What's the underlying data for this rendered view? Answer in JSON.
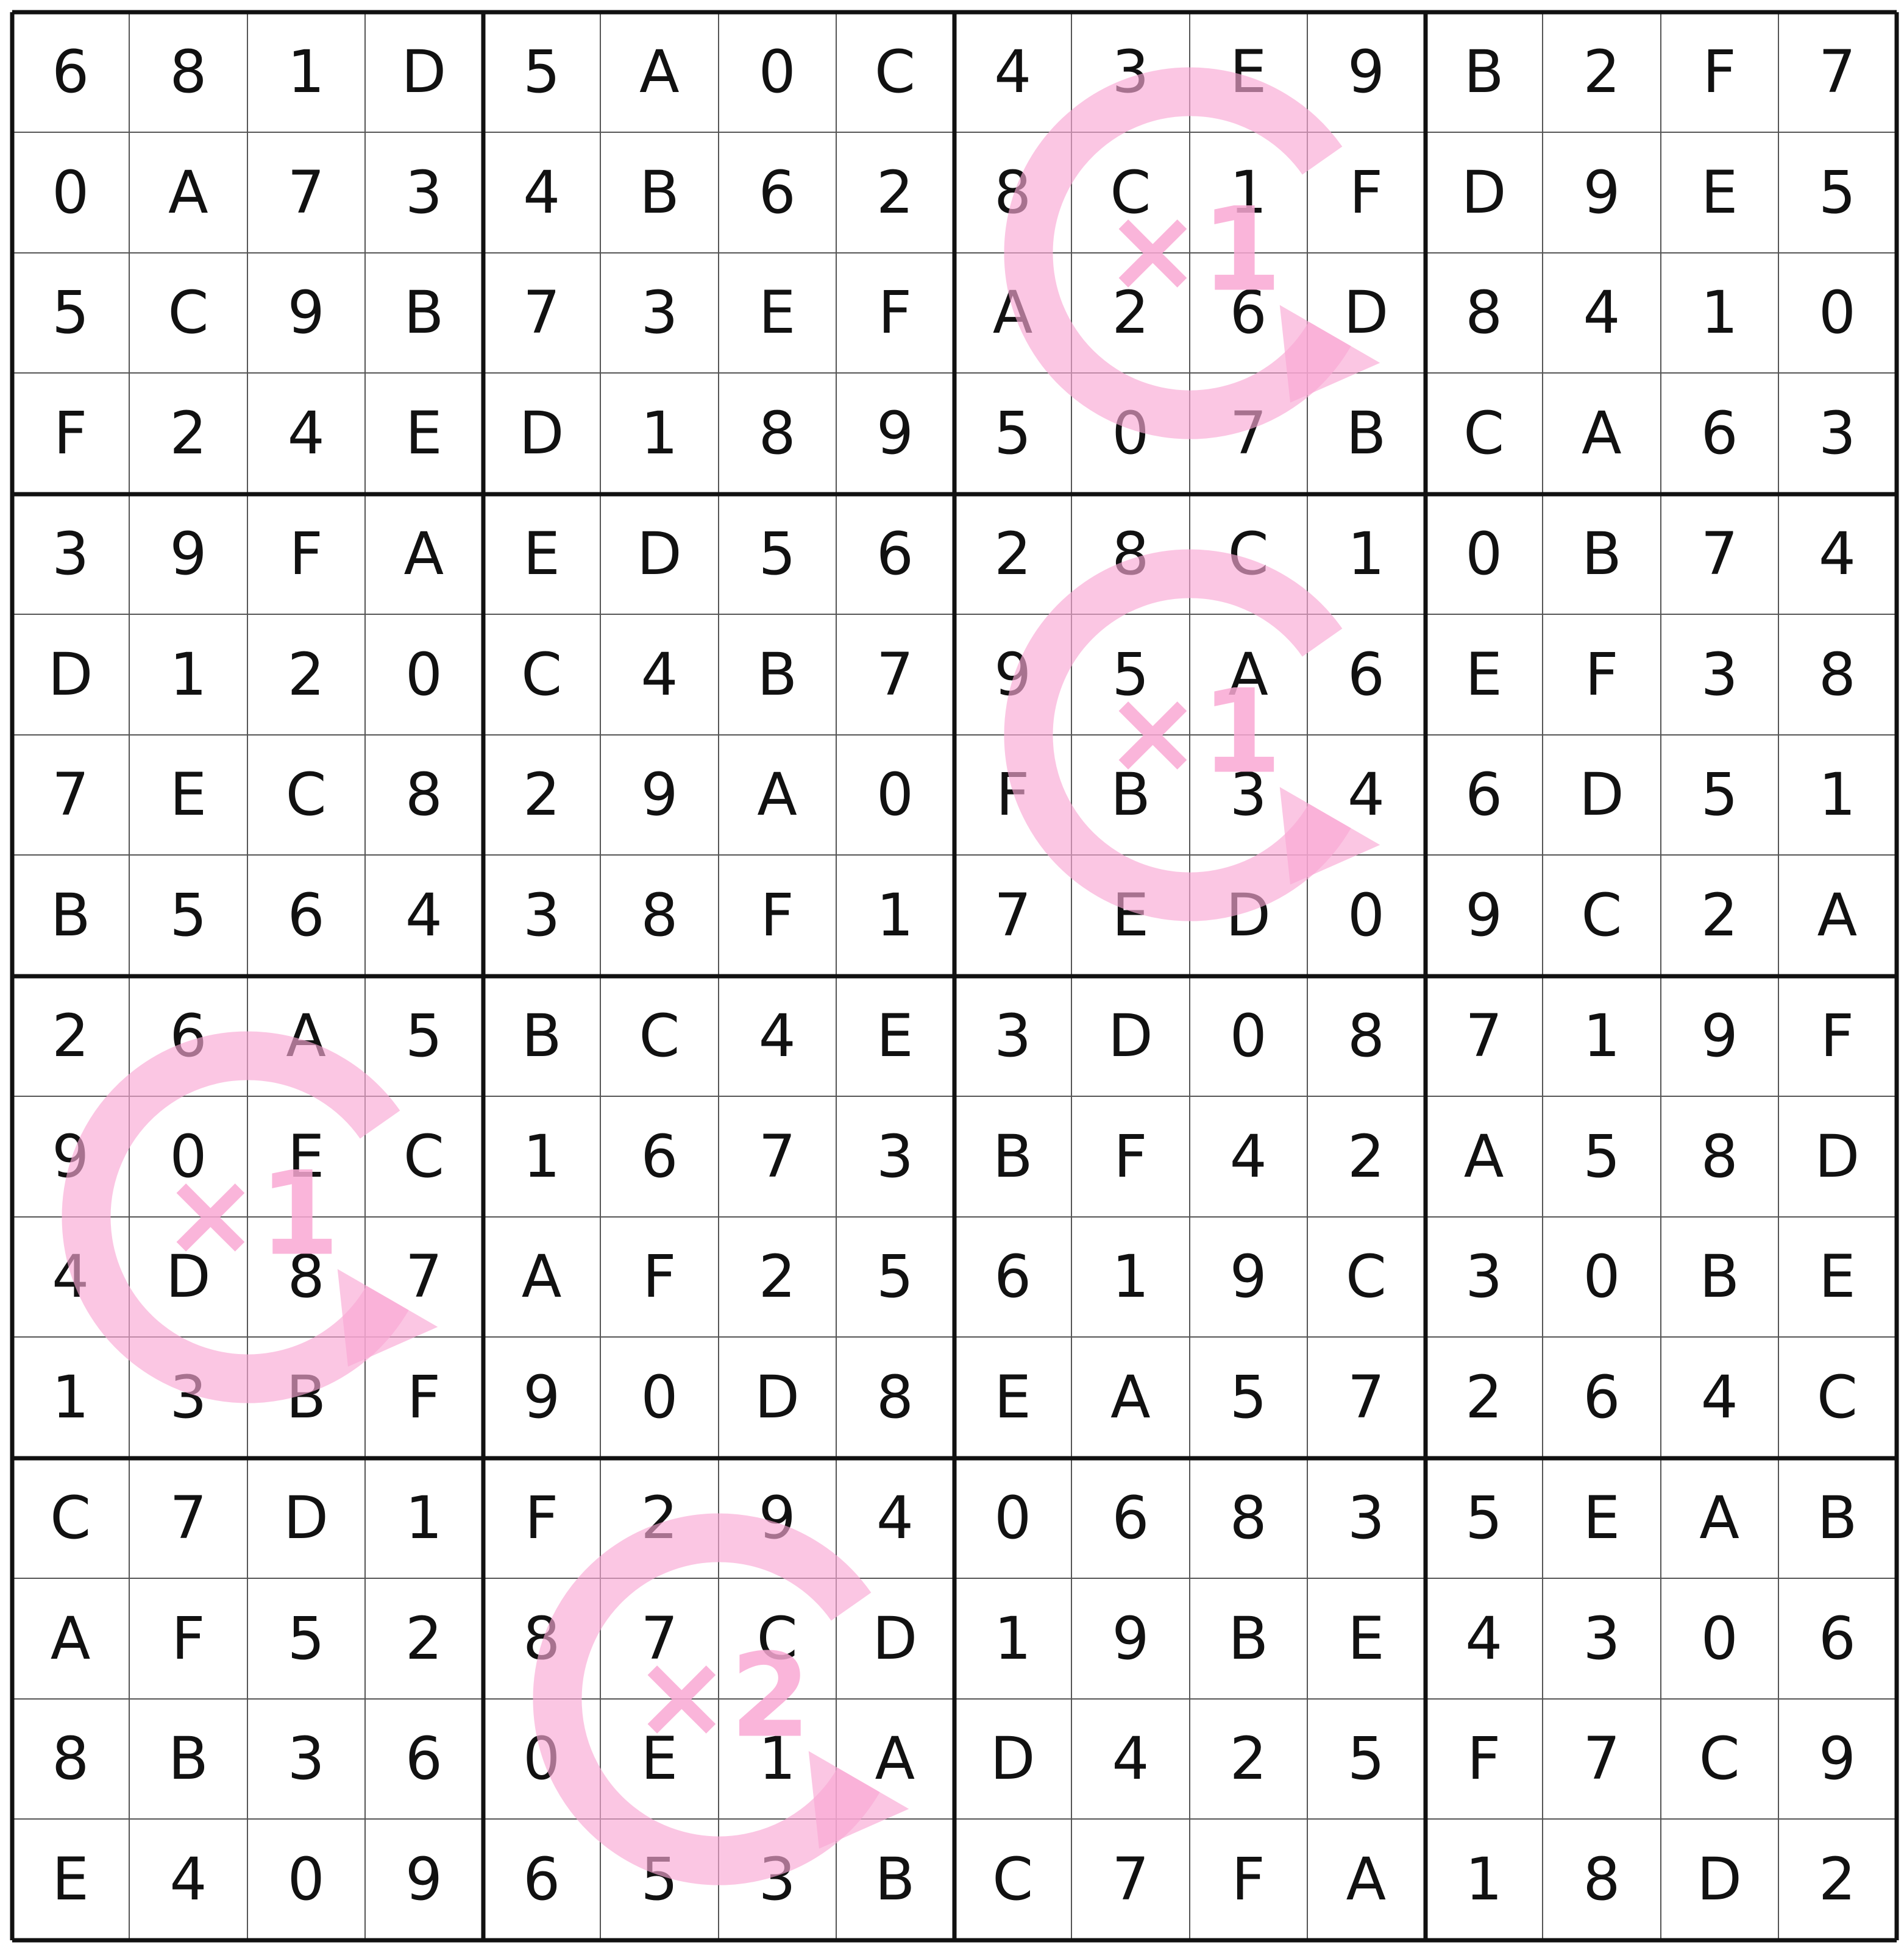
{
  "grid": [
    [
      "6",
      "8",
      "1",
      "D",
      "5",
      "A",
      "0",
      "C",
      "4",
      "3",
      "E",
      "9",
      "B",
      "2",
      "F",
      "7"
    ],
    [
      "0",
      "A",
      "7",
      "3",
      "4",
      "B",
      "6",
      "2",
      "8",
      "C",
      "1",
      "F",
      "D",
      "9",
      "E",
      "5"
    ],
    [
      "5",
      "C",
      "9",
      "B",
      "7",
      "3",
      "E",
      "F",
      "A",
      "2",
      "6",
      "D",
      "8",
      "4",
      "1",
      "0"
    ],
    [
      "F",
      "2",
      "4",
      "E",
      "D",
      "1",
      "8",
      "9",
      "5",
      "0",
      "7",
      "B",
      "C",
      "A",
      "6",
      "3"
    ],
    [
      "3",
      "9",
      "F",
      "A",
      "E",
      "D",
      "5",
      "6",
      "2",
      "8",
      "C",
      "1",
      "0",
      "B",
      "7",
      "4"
    ],
    [
      "D",
      "1",
      "2",
      "0",
      "C",
      "4",
      "B",
      "7",
      "9",
      "5",
      "A",
      "6",
      "E",
      "F",
      "3",
      "8"
    ],
    [
      "7",
      "E",
      "C",
      "8",
      "2",
      "9",
      "A",
      "0",
      "F",
      "B",
      "3",
      "4",
      "6",
      "D",
      "5",
      "1"
    ],
    [
      "B",
      "5",
      "6",
      "4",
      "3",
      "8",
      "F",
      "1",
      "7",
      "E",
      "D",
      "0",
      "9",
      "C",
      "2",
      "A"
    ],
    [
      "2",
      "6",
      "A",
      "5",
      "B",
      "C",
      "4",
      "E",
      "3",
      "D",
      "0",
      "8",
      "7",
      "1",
      "9",
      "F"
    ],
    [
      "9",
      "0",
      "E",
      "C",
      "1",
      "6",
      "7",
      "3",
      "B",
      "F",
      "4",
      "2",
      "A",
      "5",
      "8",
      "D"
    ],
    [
      "4",
      "D",
      "8",
      "7",
      "A",
      "F",
      "2",
      "5",
      "6",
      "1",
      "9",
      "C",
      "3",
      "0",
      "B",
      "E"
    ],
    [
      "1",
      "3",
      "B",
      "F",
      "9",
      "0",
      "D",
      "8",
      "E",
      "A",
      "5",
      "7",
      "2",
      "6",
      "4",
      "C"
    ],
    [
      "C",
      "7",
      "D",
      "1",
      "F",
      "2",
      "9",
      "4",
      "0",
      "6",
      "8",
      "3",
      "5",
      "E",
      "A",
      "B"
    ],
    [
      "A",
      "F",
      "5",
      "2",
      "8",
      "7",
      "C",
      "D",
      "1",
      "9",
      "B",
      "E",
      "4",
      "3",
      "0",
      "6"
    ],
    [
      "8",
      "B",
      "3",
      "6",
      "0",
      "E",
      "1",
      "A",
      "D",
      "4",
      "2",
      "5",
      "F",
      "7",
      "C",
      "9"
    ],
    [
      "E",
      "4",
      "0",
      "9",
      "6",
      "5",
      "3",
      "B",
      "C",
      "7",
      "F",
      "A",
      "1",
      "8",
      "D",
      "2"
    ]
  ],
  "rotation_markers": [
    {
      "box_row": 0,
      "box_col": 2,
      "label": "×1"
    },
    {
      "box_row": 1,
      "box_col": 2,
      "label": "×1"
    },
    {
      "box_row": 2,
      "box_col": 0,
      "label": "×1"
    },
    {
      "box_row": 3,
      "box_col": 1,
      "label": "×2"
    }
  ],
  "colors": {
    "marker": "#f9a8d4",
    "text": "#111111",
    "thin_line": "#555555",
    "thick_line": "#111111"
  },
  "icons": {
    "marker": "rotate-clockwise-arrow-icon"
  }
}
